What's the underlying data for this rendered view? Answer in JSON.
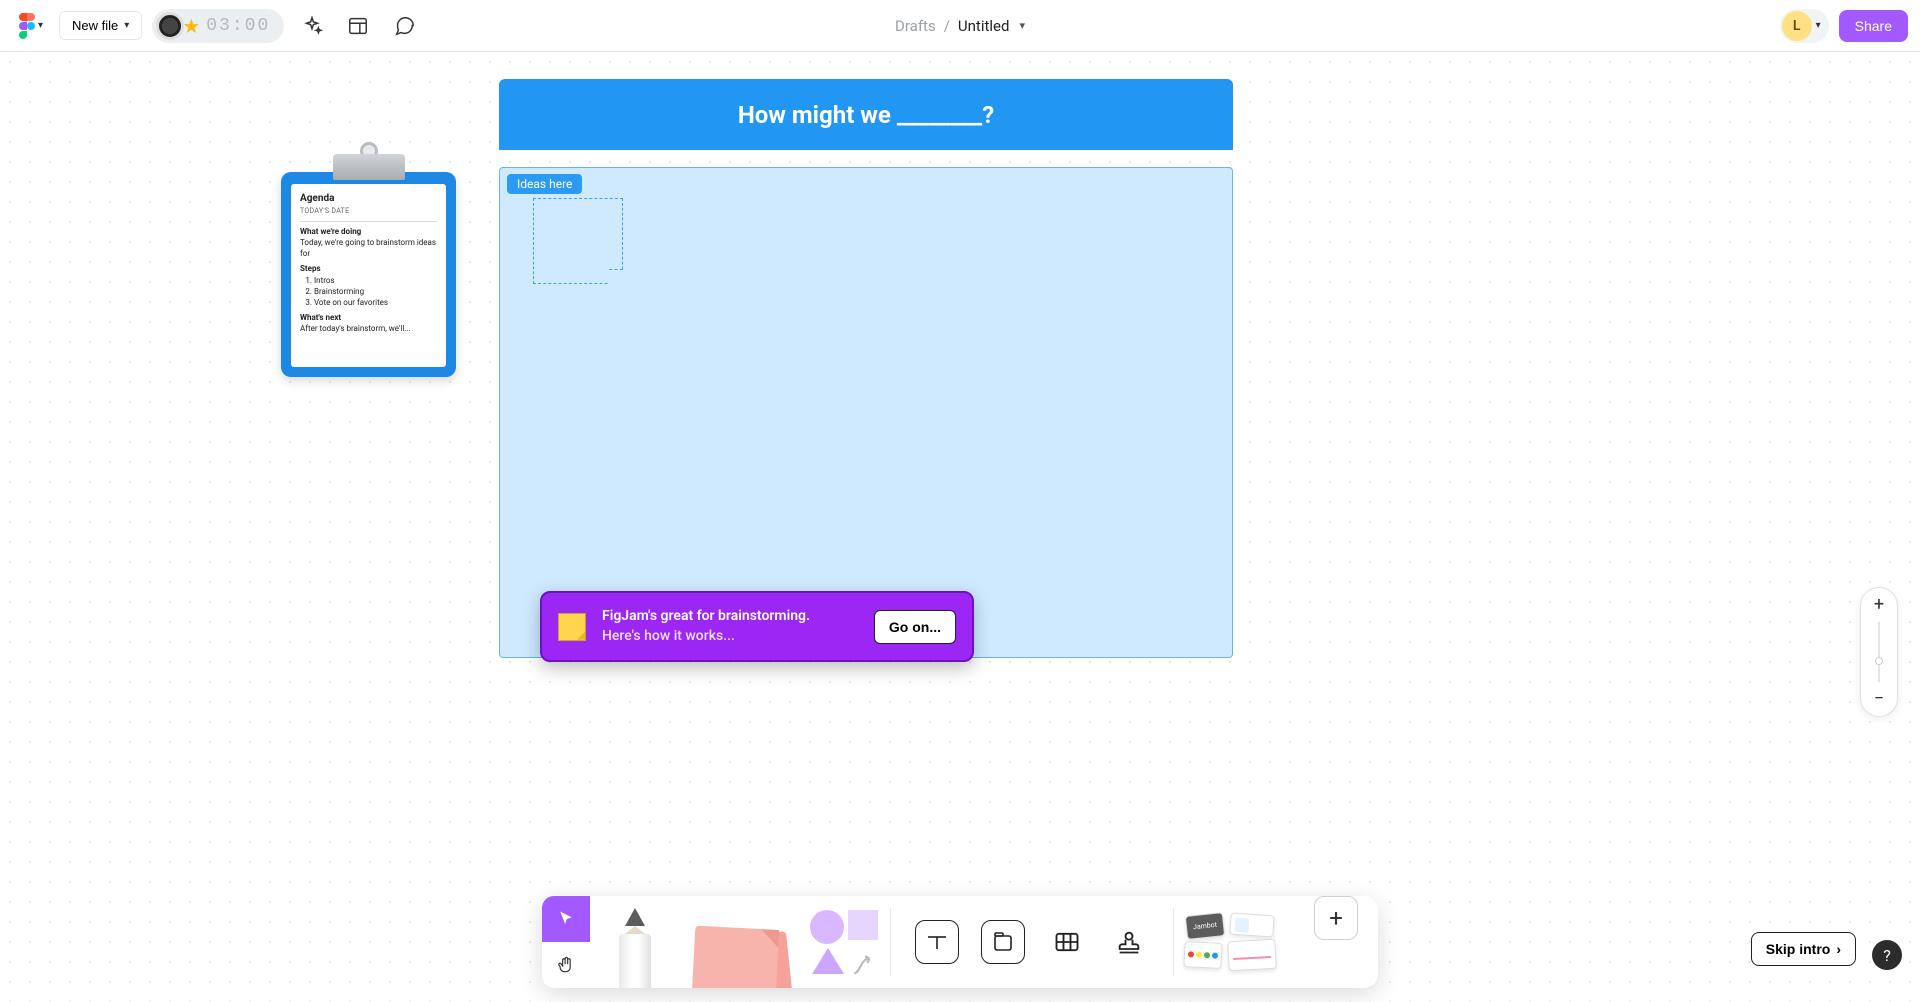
{
  "topbar": {
    "new_file_label": "New file",
    "timer_value": "03:00",
    "breadcrumb_location": "Drafts",
    "breadcrumb_title": "Untitled",
    "avatar_initial": "L",
    "share_label": "Share"
  },
  "canvas": {
    "banner_text": "How might we ________?",
    "ideas_label": "Ideas here",
    "agenda": {
      "title": "Agenda",
      "date_label": "TODAY'S DATE",
      "section1_title": "What we're doing",
      "section1_body": "Today, we're going to brainstorm ideas for",
      "steps_title": "Steps",
      "step1": "Intros",
      "step2": "Brainstorming",
      "step3": "Vote on our favorites",
      "next_title": "What's next",
      "next_body": "After today's brainstorm, we'll..."
    },
    "intro": {
      "line1": "FigJam's great for brainstorming.",
      "line2": "Here's how it works...",
      "button": "Go on..."
    }
  },
  "toolbar": {
    "widgets_label": "Jambot"
  },
  "footer": {
    "skip_label": "Skip intro",
    "help_label": "?"
  },
  "colors": {
    "accent_purple": "#a259ff",
    "banner_blue": "#2196f3",
    "ideas_bg": "#cfe9ff"
  }
}
